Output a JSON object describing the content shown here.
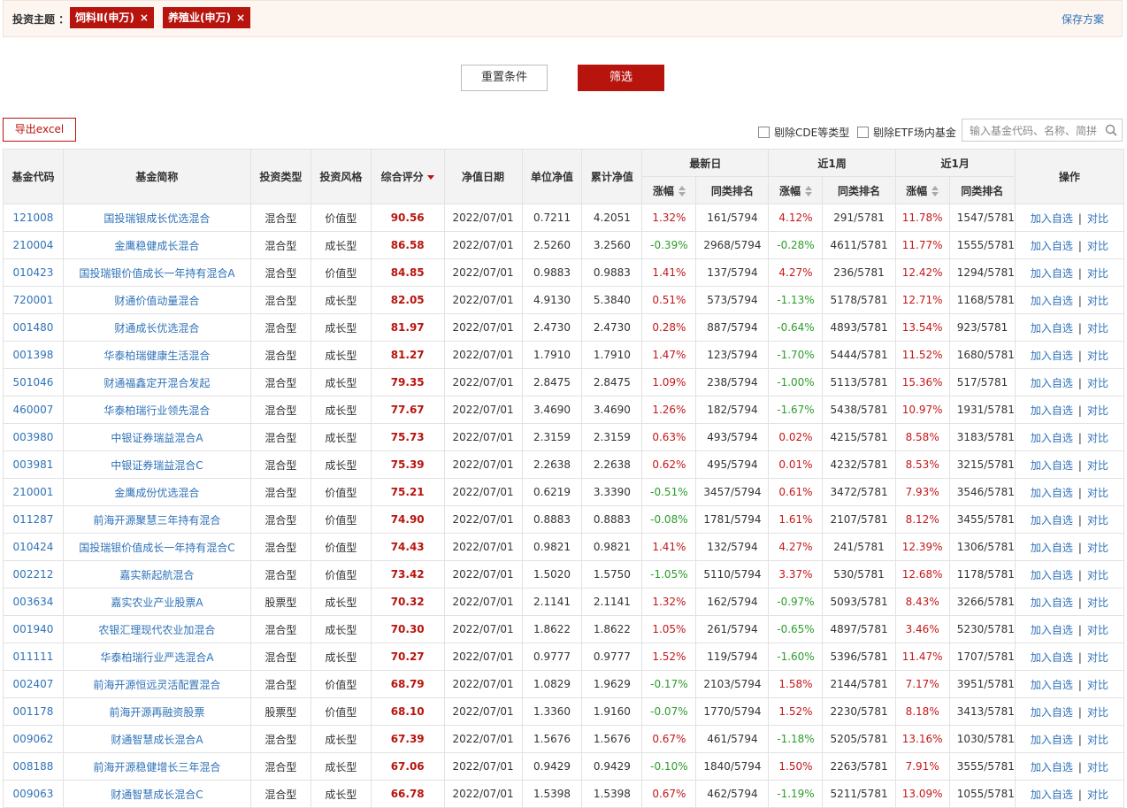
{
  "topbar": {
    "label": "投资主题 ：",
    "tags": [
      {
        "text": "饲料Ⅱ(申万)",
        "close": "×"
      },
      {
        "text": "养殖业(申万)",
        "close": "×"
      }
    ],
    "save_label": "保存方案"
  },
  "actions": {
    "reset_label": "重置条件",
    "filter_label": "筛选",
    "export_label": "导出excel",
    "exclude_cde_label": "剔除CDE等类型",
    "exclude_etf_label": "剔除ETF场内基金",
    "search_placeholder": "输入基金代码、名称、简拼"
  },
  "table": {
    "headers": {
      "code": "基金代码",
      "name": "基金简称",
      "type": "投资类型",
      "style": "投资风格",
      "score": "综合评分",
      "date": "净值日期",
      "nav": "单位净值",
      "acc_nav": "累计净值",
      "latest": "最新日",
      "week": "近1周",
      "month": "近1月",
      "ops": "操作",
      "chg": "涨幅",
      "rank": "同类排名"
    },
    "ops_labels": {
      "add": "加入自选",
      "sep": "|",
      "compare": "对比"
    },
    "rows": [
      {
        "code": "121008",
        "name": "国投瑞银成长优选混合",
        "type": "混合型",
        "style": "价值型",
        "score": "90.56",
        "date": "2022/07/01",
        "nav": "0.7211",
        "acc": "4.2051",
        "d_chg": "1.32%",
        "d_rank": "161/5794",
        "w_chg": "4.12%",
        "w_rank": "291/5781",
        "m_chg": "11.78%",
        "m_rank": "1547/5781"
      },
      {
        "code": "210004",
        "name": "金鹰稳健成长混合",
        "type": "混合型",
        "style": "成长型",
        "score": "86.58",
        "date": "2022/07/01",
        "nav": "2.5260",
        "acc": "3.2560",
        "d_chg": "-0.39%",
        "d_rank": "2968/5794",
        "w_chg": "-0.28%",
        "w_rank": "4611/5781",
        "m_chg": "11.77%",
        "m_rank": "1555/5781"
      },
      {
        "code": "010423",
        "name": "国投瑞银价值成长一年持有混合A",
        "type": "混合型",
        "style": "价值型",
        "score": "84.85",
        "date": "2022/07/01",
        "nav": "0.9883",
        "acc": "0.9883",
        "d_chg": "1.41%",
        "d_rank": "137/5794",
        "w_chg": "4.27%",
        "w_rank": "236/5781",
        "m_chg": "12.42%",
        "m_rank": "1294/5781"
      },
      {
        "code": "720001",
        "name": "财通价值动量混合",
        "type": "混合型",
        "style": "成长型",
        "score": "82.05",
        "date": "2022/07/01",
        "nav": "4.9130",
        "acc": "5.3840",
        "d_chg": "0.51%",
        "d_rank": "573/5794",
        "w_chg": "-1.13%",
        "w_rank": "5178/5781",
        "m_chg": "12.71%",
        "m_rank": "1168/5781"
      },
      {
        "code": "001480",
        "name": "财通成长优选混合",
        "type": "混合型",
        "style": "成长型",
        "score": "81.97",
        "date": "2022/07/01",
        "nav": "2.4730",
        "acc": "2.4730",
        "d_chg": "0.28%",
        "d_rank": "887/5794",
        "w_chg": "-0.64%",
        "w_rank": "4893/5781",
        "m_chg": "13.54%",
        "m_rank": "923/5781"
      },
      {
        "code": "001398",
        "name": "华泰柏瑞健康生活混合",
        "type": "混合型",
        "style": "成长型",
        "score": "81.27",
        "date": "2022/07/01",
        "nav": "1.7910",
        "acc": "1.7910",
        "d_chg": "1.47%",
        "d_rank": "123/5794",
        "w_chg": "-1.70%",
        "w_rank": "5444/5781",
        "m_chg": "11.52%",
        "m_rank": "1680/5781"
      },
      {
        "code": "501046",
        "name": "财通福鑫定开混合发起",
        "type": "混合型",
        "style": "成长型",
        "score": "79.35",
        "date": "2022/07/01",
        "nav": "2.8475",
        "acc": "2.8475",
        "d_chg": "1.09%",
        "d_rank": "238/5794",
        "w_chg": "-1.00%",
        "w_rank": "5113/5781",
        "m_chg": "15.36%",
        "m_rank": "517/5781"
      },
      {
        "code": "460007",
        "name": "华泰柏瑞行业领先混合",
        "type": "混合型",
        "style": "成长型",
        "score": "77.67",
        "date": "2022/07/01",
        "nav": "3.4690",
        "acc": "3.4690",
        "d_chg": "1.26%",
        "d_rank": "182/5794",
        "w_chg": "-1.67%",
        "w_rank": "5438/5781",
        "m_chg": "10.97%",
        "m_rank": "1931/5781"
      },
      {
        "code": "003980",
        "name": "中银证券瑞益混合A",
        "type": "混合型",
        "style": "成长型",
        "score": "75.73",
        "date": "2022/07/01",
        "nav": "2.3159",
        "acc": "2.3159",
        "d_chg": "0.63%",
        "d_rank": "493/5794",
        "w_chg": "0.02%",
        "w_rank": "4215/5781",
        "m_chg": "8.58%",
        "m_rank": "3183/5781"
      },
      {
        "code": "003981",
        "name": "中银证券瑞益混合C",
        "type": "混合型",
        "style": "成长型",
        "score": "75.39",
        "date": "2022/07/01",
        "nav": "2.2638",
        "acc": "2.2638",
        "d_chg": "0.62%",
        "d_rank": "495/5794",
        "w_chg": "0.01%",
        "w_rank": "4232/5781",
        "m_chg": "8.53%",
        "m_rank": "3215/5781"
      },
      {
        "code": "210001",
        "name": "金鹰成份优选混合",
        "type": "混合型",
        "style": "价值型",
        "score": "75.21",
        "date": "2022/07/01",
        "nav": "0.6219",
        "acc": "3.3390",
        "d_chg": "-0.51%",
        "d_rank": "3457/5794",
        "w_chg": "0.61%",
        "w_rank": "3472/5781",
        "m_chg": "7.93%",
        "m_rank": "3546/5781"
      },
      {
        "code": "011287",
        "name": "前海开源聚慧三年持有混合",
        "type": "混合型",
        "style": "价值型",
        "score": "74.90",
        "date": "2022/07/01",
        "nav": "0.8883",
        "acc": "0.8883",
        "d_chg": "-0.08%",
        "d_rank": "1781/5794",
        "w_chg": "1.61%",
        "w_rank": "2107/5781",
        "m_chg": "8.12%",
        "m_rank": "3455/5781"
      },
      {
        "code": "010424",
        "name": "国投瑞银价值成长一年持有混合C",
        "type": "混合型",
        "style": "价值型",
        "score": "74.43",
        "date": "2022/07/01",
        "nav": "0.9821",
        "acc": "0.9821",
        "d_chg": "1.41%",
        "d_rank": "132/5794",
        "w_chg": "4.27%",
        "w_rank": "241/5781",
        "m_chg": "12.39%",
        "m_rank": "1306/5781"
      },
      {
        "code": "002212",
        "name": "嘉实新起航混合",
        "type": "混合型",
        "style": "价值型",
        "score": "73.42",
        "date": "2022/07/01",
        "nav": "1.5020",
        "acc": "1.5750",
        "d_chg": "-1.05%",
        "d_rank": "5110/5794",
        "w_chg": "3.37%",
        "w_rank": "530/5781",
        "m_chg": "12.68%",
        "m_rank": "1178/5781"
      },
      {
        "code": "003634",
        "name": "嘉实农业产业股票A",
        "type": "股票型",
        "style": "成长型",
        "score": "70.32",
        "date": "2022/07/01",
        "nav": "2.1141",
        "acc": "2.1141",
        "d_chg": "1.32%",
        "d_rank": "162/5794",
        "w_chg": "-0.97%",
        "w_rank": "5093/5781",
        "m_chg": "8.43%",
        "m_rank": "3266/5781"
      },
      {
        "code": "001940",
        "name": "农银汇理现代农业加混合",
        "type": "混合型",
        "style": "成长型",
        "score": "70.30",
        "date": "2022/07/01",
        "nav": "1.8622",
        "acc": "1.8622",
        "d_chg": "1.05%",
        "d_rank": "261/5794",
        "w_chg": "-0.65%",
        "w_rank": "4897/5781",
        "m_chg": "3.46%",
        "m_rank": "5230/5781"
      },
      {
        "code": "011111",
        "name": "华泰柏瑞行业严选混合A",
        "type": "混合型",
        "style": "成长型",
        "score": "70.27",
        "date": "2022/07/01",
        "nav": "0.9777",
        "acc": "0.9777",
        "d_chg": "1.52%",
        "d_rank": "119/5794",
        "w_chg": "-1.60%",
        "w_rank": "5396/5781",
        "m_chg": "11.47%",
        "m_rank": "1707/5781"
      },
      {
        "code": "002407",
        "name": "前海开源恒远灵活配置混合",
        "type": "混合型",
        "style": "价值型",
        "score": "68.79",
        "date": "2022/07/01",
        "nav": "1.0829",
        "acc": "1.9629",
        "d_chg": "-0.17%",
        "d_rank": "2103/5794",
        "w_chg": "1.58%",
        "w_rank": "2144/5781",
        "m_chg": "7.17%",
        "m_rank": "3951/5781"
      },
      {
        "code": "001178",
        "name": "前海开源再融资股票",
        "type": "股票型",
        "style": "价值型",
        "score": "68.10",
        "date": "2022/07/01",
        "nav": "1.3360",
        "acc": "1.9160",
        "d_chg": "-0.07%",
        "d_rank": "1770/5794",
        "w_chg": "1.52%",
        "w_rank": "2230/5781",
        "m_chg": "8.18%",
        "m_rank": "3413/5781"
      },
      {
        "code": "009062",
        "name": "财通智慧成长混合A",
        "type": "混合型",
        "style": "成长型",
        "score": "67.39",
        "date": "2022/07/01",
        "nav": "1.5676",
        "acc": "1.5676",
        "d_chg": "0.67%",
        "d_rank": "461/5794",
        "w_chg": "-1.18%",
        "w_rank": "5205/5781",
        "m_chg": "13.16%",
        "m_rank": "1030/5781"
      },
      {
        "code": "008188",
        "name": "前海开源稳健增长三年混合",
        "type": "混合型",
        "style": "成长型",
        "score": "67.06",
        "date": "2022/07/01",
        "nav": "0.9429",
        "acc": "0.9429",
        "d_chg": "-0.10%",
        "d_rank": "1840/5794",
        "w_chg": "1.50%",
        "w_rank": "2263/5781",
        "m_chg": "7.91%",
        "m_rank": "3555/5781"
      },
      {
        "code": "009063",
        "name": "财通智慧成长混合C",
        "type": "混合型",
        "style": "成长型",
        "score": "66.78",
        "date": "2022/07/01",
        "nav": "1.5398",
        "acc": "1.5398",
        "d_chg": "0.67%",
        "d_rank": "462/5794",
        "w_chg": "-1.19%",
        "w_rank": "5211/5781",
        "m_chg": "13.09%",
        "m_rank": "1055/5781"
      }
    ]
  },
  "colors": {
    "accent": "#b8140e",
    "link": "#2f72b8",
    "up": "#c3181a",
    "down": "#2b9d2b"
  }
}
